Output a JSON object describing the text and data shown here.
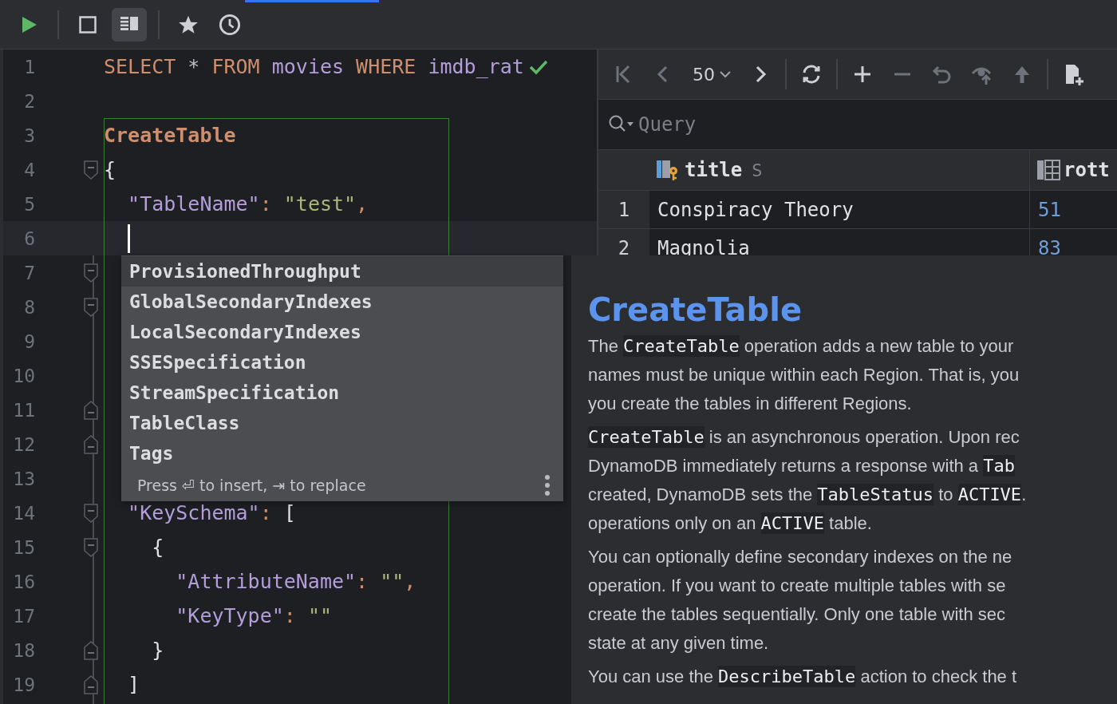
{
  "toolbar": {
    "buttons": [
      {
        "kind": "run",
        "selected": false
      },
      {
        "kind": "stop",
        "selected": false
      },
      {
        "kind": "layout",
        "selected": true
      },
      {
        "kind": "star",
        "selected": false
      },
      {
        "kind": "history",
        "selected": false
      }
    ]
  },
  "editor": {
    "lines": [
      {
        "n": "1",
        "fold_start": false,
        "fold_end": false,
        "current": false,
        "check": true,
        "tokens": [
          {
            "kind": "kw",
            "text": "SELECT"
          },
          {
            "kind": "plain",
            "text": " * "
          },
          {
            "kind": "kw",
            "text": "FROM"
          },
          {
            "kind": "ident",
            "text": " movies "
          },
          {
            "kind": "kw",
            "text": "WHERE"
          },
          {
            "kind": "ident",
            "text": " imdb_rat"
          }
        ]
      },
      {
        "n": "2",
        "fold_start": false,
        "fold_end": false,
        "current": false,
        "check": false
      },
      {
        "n": "3",
        "fold_start": false,
        "fold_end": false,
        "current": false,
        "check": false,
        "tokens": [
          {
            "kind": "kwb",
            "text": "CreateTable"
          }
        ]
      },
      {
        "n": "4",
        "fold_start": true,
        "fold_end": false,
        "current": false,
        "check": false,
        "tokens": [
          {
            "kind": "brace",
            "text": "{"
          }
        ]
      },
      {
        "n": "5",
        "fold_start": false,
        "fold_end": false,
        "current": false,
        "check": false,
        "tokens": [
          {
            "kind": "key",
            "text": "  \"TableName\""
          },
          {
            "kind": "punct",
            "text": ": "
          },
          {
            "kind": "str",
            "text": "\"test\""
          },
          {
            "kind": "punct",
            "text": ","
          }
        ]
      },
      {
        "n": "6",
        "fold_start": false,
        "fold_end": false,
        "current": true,
        "check": false
      },
      {
        "n": "7",
        "fold_start": true,
        "fold_end": false,
        "current": false,
        "check": false
      },
      {
        "n": "8",
        "fold_start": true,
        "fold_end": false,
        "current": false,
        "check": false
      },
      {
        "n": "9",
        "fold_start": false,
        "fold_end": false,
        "current": false,
        "check": false
      },
      {
        "n": "10",
        "fold_start": false,
        "fold_end": false,
        "current": false,
        "check": false
      },
      {
        "n": "11",
        "fold_start": false,
        "fold_end": true,
        "current": false,
        "check": false
      },
      {
        "n": "12",
        "fold_start": false,
        "fold_end": true,
        "current": false,
        "check": false
      },
      {
        "n": "13",
        "fold_start": false,
        "fold_end": false,
        "current": false,
        "check": false
      },
      {
        "n": "14",
        "fold_start": true,
        "fold_end": false,
        "current": false,
        "check": false,
        "tokens": [
          {
            "kind": "key",
            "text": "  \"KeySchema\""
          },
          {
            "kind": "punct",
            "text": ": "
          },
          {
            "kind": "brace",
            "text": "["
          }
        ]
      },
      {
        "n": "15",
        "fold_start": true,
        "fold_end": false,
        "current": false,
        "check": false,
        "tokens": [
          {
            "kind": "brace",
            "text": "    {"
          }
        ]
      },
      {
        "n": "16",
        "fold_start": false,
        "fold_end": false,
        "current": false,
        "check": false,
        "tokens": [
          {
            "kind": "key",
            "text": "      \"AttributeName\""
          },
          {
            "kind": "punct",
            "text": ": "
          },
          {
            "kind": "str",
            "text": "\"\""
          },
          {
            "kind": "punct",
            "text": ","
          }
        ]
      },
      {
        "n": "17",
        "fold_start": false,
        "fold_end": false,
        "current": false,
        "check": false,
        "tokens": [
          {
            "kind": "key",
            "text": "      \"KeyType\""
          },
          {
            "kind": "punct",
            "text": ": "
          },
          {
            "kind": "str",
            "text": "\"\""
          }
        ]
      },
      {
        "n": "18",
        "fold_start": false,
        "fold_end": true,
        "current": false,
        "check": false,
        "tokens": [
          {
            "kind": "brace",
            "text": "    }"
          }
        ]
      },
      {
        "n": "19",
        "fold_start": false,
        "fold_end": true,
        "current": false,
        "check": false,
        "tokens": [
          {
            "kind": "brace",
            "text": "  ]"
          }
        ]
      }
    ]
  },
  "results": {
    "toolbar": [
      {
        "kind": "first",
        "disabled": true
      },
      {
        "kind": "prev",
        "disabled": true
      },
      {
        "kind": "pagesize",
        "label": "50",
        "disabled": false
      },
      {
        "kind": "next",
        "disabled": false
      },
      {
        "kind": "sep"
      },
      {
        "kind": "refresh",
        "disabled": false
      },
      {
        "kind": "sep"
      },
      {
        "kind": "add",
        "disabled": false
      },
      {
        "kind": "remove",
        "disabled": true
      },
      {
        "kind": "revert",
        "disabled": true
      },
      {
        "kind": "view",
        "disabled": true
      },
      {
        "kind": "submit",
        "disabled": true
      },
      {
        "kind": "sep"
      },
      {
        "kind": "addfile",
        "disabled": false
      }
    ],
    "search": {
      "placeholder": "Query"
    },
    "columns": [
      {
        "kind": "key",
        "name": "title",
        "type": "S"
      },
      {
        "kind": "plain",
        "name": "rott"
      }
    ],
    "rows": [
      {
        "n": "1",
        "cells": [
          "Conspiracy Theory",
          "51"
        ]
      },
      {
        "n": "2",
        "cells": [
          "Magnolia",
          "83"
        ]
      }
    ]
  },
  "completion": {
    "items": [
      {
        "label": "ProvisionedThroughput",
        "selected": true
      },
      {
        "label": "GlobalSecondaryIndexes",
        "selected": false
      },
      {
        "label": "LocalSecondaryIndexes",
        "selected": false
      },
      {
        "label": "SSESpecification",
        "selected": false
      },
      {
        "label": "StreamSpecification",
        "selected": false
      },
      {
        "label": "TableClass",
        "selected": false
      },
      {
        "label": "Tags",
        "selected": false
      }
    ],
    "hint": "Press ⏎ to insert, ⇥ to replace"
  },
  "documentation": {
    "title": "CreateTable",
    "paragraphs": [
      [
        [
          {
            "kind": "text",
            "text": "The "
          },
          {
            "kind": "code",
            "text": "CreateTable"
          },
          {
            "kind": "text",
            "text": " operation adds a new table to your"
          }
        ],
        [
          {
            "kind": "text",
            "text": "names must be unique within each Region. That is, you"
          }
        ],
        [
          {
            "kind": "text",
            "text": "you create the tables in different Regions."
          }
        ]
      ],
      [
        [
          {
            "kind": "code",
            "text": "CreateTable"
          },
          {
            "kind": "text",
            "text": " is an asynchronous operation. Upon rec"
          }
        ],
        [
          {
            "kind": "text",
            "text": "DynamoDB immediately returns a response with a "
          },
          {
            "kind": "code",
            "text": "Tab"
          }
        ],
        [
          {
            "kind": "text",
            "text": "created, DynamoDB sets the "
          },
          {
            "kind": "code",
            "text": "TableStatus"
          },
          {
            "kind": "text",
            "text": " to "
          },
          {
            "kind": "code",
            "text": "ACTIVE"
          },
          {
            "kind": "text",
            "text": "."
          }
        ],
        [
          {
            "kind": "text",
            "text": "operations only on an "
          },
          {
            "kind": "code",
            "text": "ACTIVE"
          },
          {
            "kind": "text",
            "text": " table."
          }
        ]
      ],
      [
        [
          {
            "kind": "text",
            "text": "You can optionally define secondary indexes on the ne"
          }
        ],
        [
          {
            "kind": "text",
            "text": "operation. If you want to create multiple tables with se"
          }
        ],
        [
          {
            "kind": "text",
            "text": "create the tables sequentially. Only one table with sec"
          }
        ],
        [
          {
            "kind": "text",
            "text": "state at any given time."
          }
        ]
      ],
      [
        [
          {
            "kind": "text",
            "text": "You can use the "
          },
          {
            "kind": "code",
            "text": "DescribeTable"
          },
          {
            "kind": "text",
            "text": " action to check the t"
          }
        ]
      ]
    ]
  }
}
